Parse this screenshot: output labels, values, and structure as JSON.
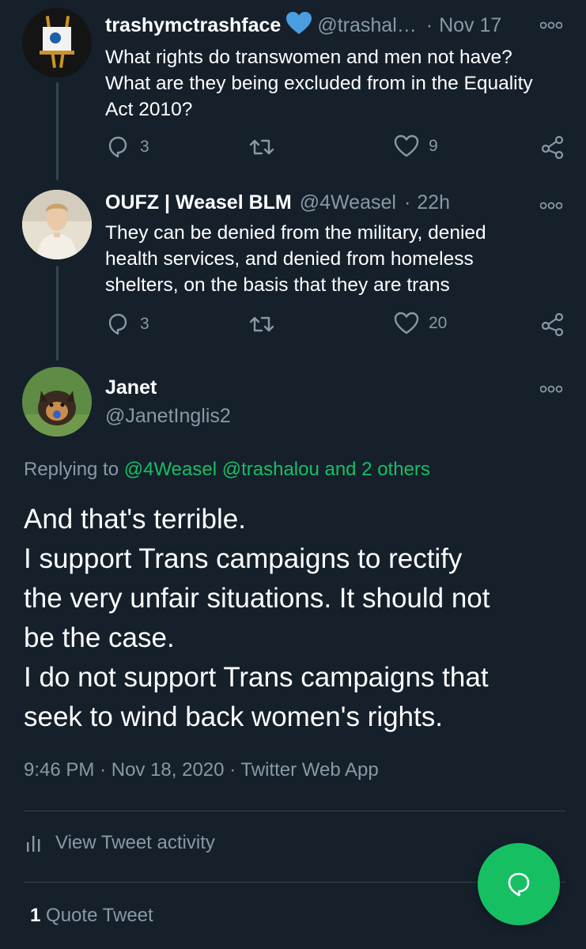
{
  "tweets": [
    {
      "name": "trashymctrashface",
      "handle": "@trashal…",
      "separator": "·",
      "time": "Nov 17",
      "text_lines": [
        "What rights do transwomen and men not have?",
        "What are they being excluded from in the Equality",
        "Act 2010?"
      ],
      "replies": "3",
      "likes": "9",
      "verified_icon": "heart-verified-icon"
    },
    {
      "name": "OUFZ | Weasel BLM",
      "handle": "@4Weasel",
      "separator": "·",
      "time": "22h",
      "text_lines": [
        "They can be denied from the military, denied",
        "health services, and denied from homeless",
        "shelters, on the basis that they are trans"
      ],
      "replies": "3",
      "likes": "20"
    }
  ],
  "main_tweet": {
    "name": "Janet",
    "handle": "@JanetInglis2",
    "replying_prefix": "Replying to",
    "replying_targets": "@4Weasel @trashalou and 2 others",
    "text_lines": [
      "And that's terrible.",
      "I support Trans campaigns to rectify",
      "the very unfair situations. It should not",
      "be the case.",
      "I do not support Trans campaigns that",
      "seek to wind back women's rights."
    ],
    "time": "9:46 PM",
    "date": "Nov 18, 2020",
    "source": "Twitter Web App",
    "activity_label": "View Tweet activity",
    "quote_count": "1",
    "quote_label": "Quote Tweet"
  },
  "colors": {
    "background": "#15202b",
    "accent": "#17bf63",
    "muted": "#8899a6",
    "divider": "#38444d",
    "verified": "#4a9ee0"
  },
  "icons": [
    "reply-icon",
    "retweet-icon",
    "like-icon",
    "share-icon",
    "more-icon",
    "activity-icon",
    "compose-reply-icon"
  ]
}
